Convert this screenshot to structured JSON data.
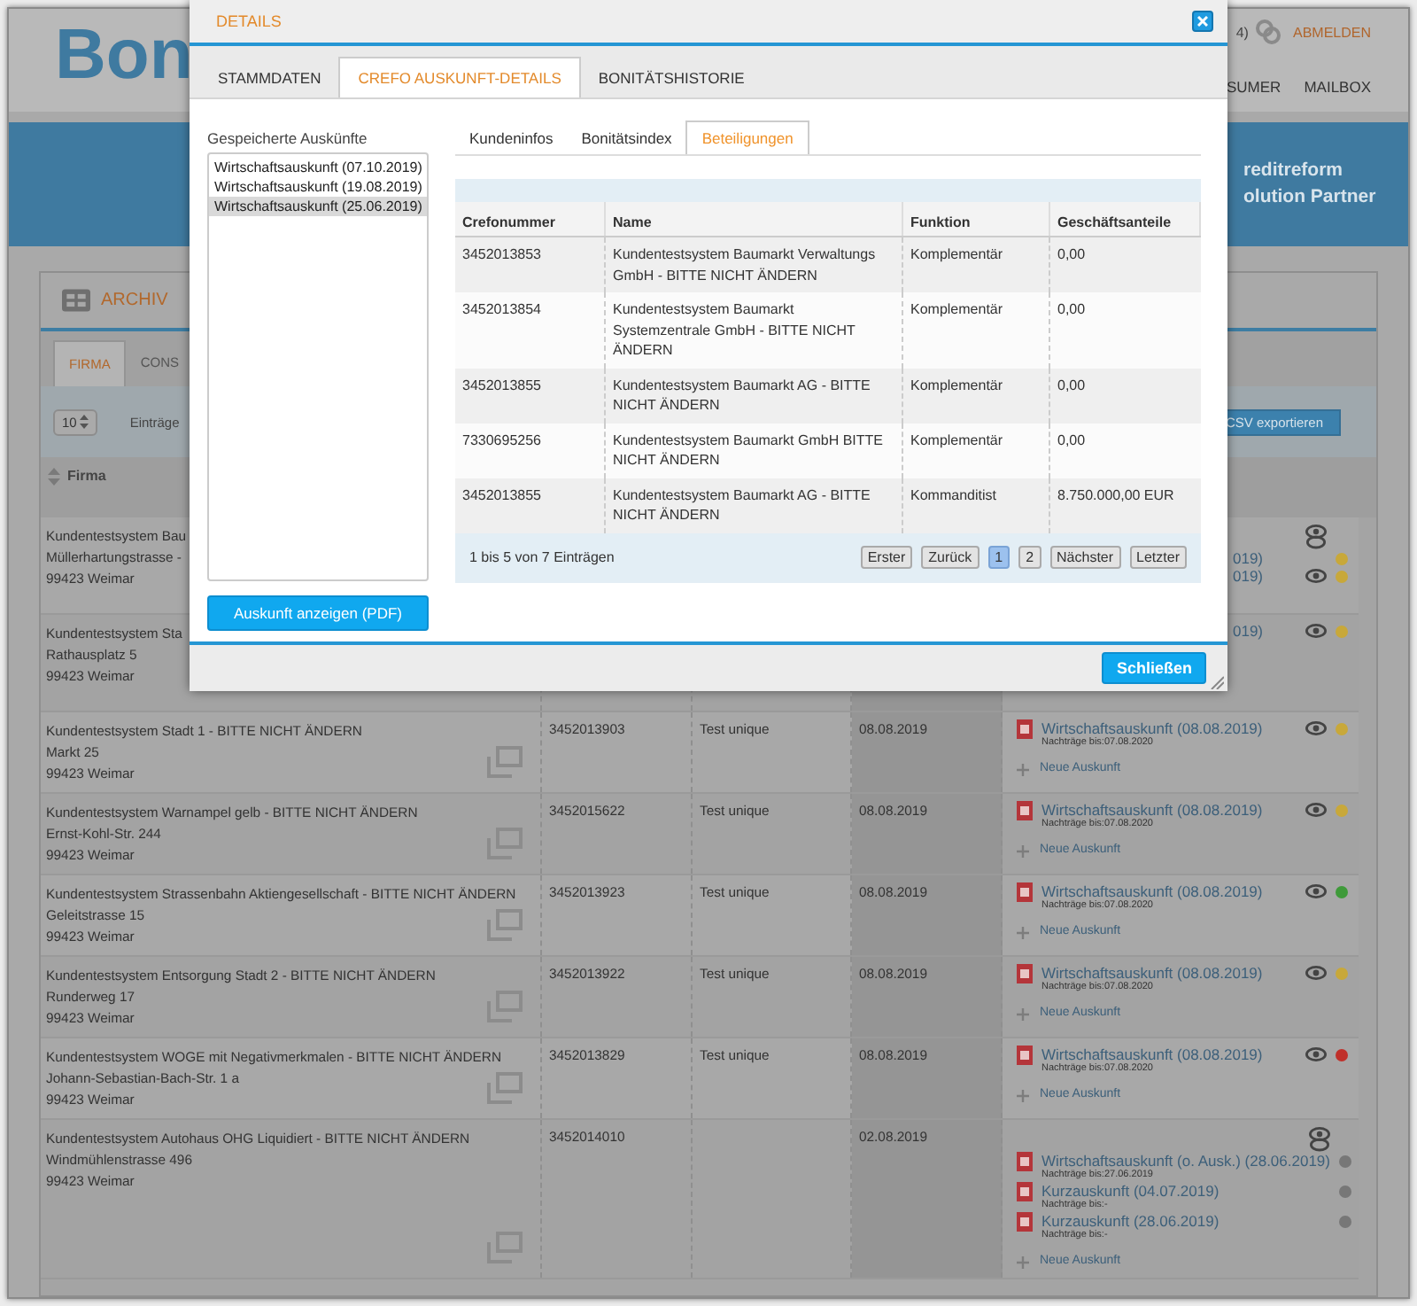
{
  "header": {
    "logo": "Bon",
    "badge": "4)",
    "logout": "ABMELDEN",
    "nav": [
      "SUMER",
      "MAILBOX"
    ]
  },
  "banner": {
    "lines": [
      "reditreform",
      "olution Partner"
    ]
  },
  "archive": {
    "title": "ARCHIV",
    "tabs": [
      {
        "label": "FIRMA",
        "selected": true
      },
      {
        "label": "CONS",
        "selected": false
      }
    ],
    "page_size": "10",
    "entries_label": "Einträge",
    "export_button": "CSV exportieren",
    "column_header": "Firma",
    "rows": [
      {
        "company": "Kundentestsystem Bau",
        "street": "Müllerhartungstrasse -",
        "city": "99423 Weimar",
        "double_eye": true,
        "reports": [
          {
            "title": "019)",
            "color": "#c8a83a",
            "eye": false
          },
          {
            "title": "019)",
            "color": "#c8a83a",
            "eye": true
          }
        ]
      },
      {
        "company": "Kundentestsystem Sta",
        "street": "Rathausplatz 5",
        "city": "99423 Weimar",
        "reports": [
          {
            "title": "019)",
            "color": "#c8a83a",
            "eye": true
          }
        ]
      },
      {
        "company": "Kundentestsystem Stadt 1 - BITTE NICHT ÄNDERN",
        "street": "Markt 25",
        "city": "99423 Weimar",
        "crefo": "3452013903",
        "ref": "Test unique",
        "date": "08.08.2019",
        "reports": [
          {
            "title": "Wirtschaftsauskunft (08.08.2019)",
            "note": "Nachträge bis:07.08.2020",
            "color": "#c8a83a",
            "eye": true
          }
        ],
        "new_report": "Neue Auskunft"
      },
      {
        "company": "Kundentestsystem Warnampel gelb - BITTE NICHT ÄNDERN",
        "street": "Ernst-Kohl-Str. 244",
        "city": "99423 Weimar",
        "crefo": "3452015622",
        "ref": "Test unique",
        "date": "08.08.2019",
        "reports": [
          {
            "title": "Wirtschaftsauskunft (08.08.2019)",
            "note": "Nachträge bis:07.08.2020",
            "color": "#c8a83a",
            "eye": true
          }
        ],
        "new_report": "Neue Auskunft"
      },
      {
        "company": "Kundentestsystem Strassenbahn Aktiengesellschaft - BITTE NICHT ÄNDERN",
        "street": "Geleitstrasse 15",
        "city": "99423 Weimar",
        "crefo": "3452013923",
        "ref": "Test unique",
        "date": "08.08.2019",
        "reports": [
          {
            "title": "Wirtschaftsauskunft (08.08.2019)",
            "note": "Nachträge bis:07.08.2020",
            "color": "#3f9a3a",
            "eye": true
          }
        ],
        "new_report": "Neue Auskunft"
      },
      {
        "company": "Kundentestsystem Entsorgung Stadt 2 - BITTE NICHT ÄNDERN",
        "street": "Runderweg 17",
        "city": "99423 Weimar",
        "crefo": "3452013922",
        "ref": "Test unique",
        "date": "08.08.2019",
        "reports": [
          {
            "title": "Wirtschaftsauskunft (08.08.2019)",
            "note": "Nachträge bis:07.08.2020",
            "color": "#c8a83a",
            "eye": true
          }
        ],
        "new_report": "Neue Auskunft"
      },
      {
        "company": "Kundentestsystem WOGE mit Negativmerkmalen - BITTE NICHT ÄNDERN",
        "street": "Johann-Sebastian-Bach-Str. 1 a",
        "city": "99423 Weimar",
        "crefo": "3452013829",
        "ref": "Test unique",
        "date": "08.08.2019",
        "reports": [
          {
            "title": "Wirtschaftsauskunft (08.08.2019)",
            "note": "Nachträge bis:07.08.2020",
            "color": "#c0302a",
            "eye": true
          }
        ],
        "new_report": "Neue Auskunft"
      },
      {
        "company": "Kundentestsystem Autohaus OHG Liquidiert - BITTE NICHT ÄNDERN",
        "street": "Windmühlenstrasse 496",
        "city": "99423 Weimar",
        "crefo": "3452014010",
        "date": "02.08.2019",
        "double_eye": true,
        "reports": [
          {
            "title": "Wirtschaftsauskunft (o. Ausk.) (28.06.2019)",
            "note": "Nachträge bis:27.06.2019",
            "color": "#777777",
            "eye": false
          },
          {
            "title": "Kurzauskunft (04.07.2019)",
            "note": "Nachträge bis:-",
            "color": "#777777",
            "eye": false
          },
          {
            "title": "Kurzauskunft (28.06.2019)",
            "note": "Nachträge bis:-",
            "color": "#777777",
            "eye": false
          }
        ],
        "new_report": "Neue Auskunft"
      }
    ]
  },
  "dialog": {
    "title": "DETAILS",
    "tabs": [
      {
        "label": "STAMMDATEN",
        "selected": false
      },
      {
        "label": "CREFO AUSKUNFT-DETAILS",
        "selected": true
      },
      {
        "label": "BONITÄTSHISTORIE",
        "selected": false
      }
    ],
    "saved_label": "Gespeicherte Auskünfte",
    "saved": [
      {
        "label": "Wirtschaftsauskunft (07.10.2019)",
        "selected": false
      },
      {
        "label": "Wirtschaftsauskunft (19.08.2019)",
        "selected": false
      },
      {
        "label": "Wirtschaftsauskunft (25.06.2019)",
        "selected": true
      }
    ],
    "pdf_button": "Auskunft anzeigen (PDF)",
    "subtabs": [
      {
        "label": "Kundeninfos",
        "selected": false
      },
      {
        "label": "Bonitätsindex",
        "selected": false
      },
      {
        "label": "Beteiligungen",
        "selected": true
      }
    ],
    "table": {
      "columns": [
        "Crefonummer",
        "Name",
        "Funktion",
        "Geschäftsanteile"
      ],
      "rows": [
        [
          "3452013853",
          "Kundentestsystem Baumarkt Verwaltungs GmbH - BITTE NICHT ÄNDERN",
          "Komplementär",
          "0,00"
        ],
        [
          "3452013854",
          "Kundentestsystem Baumarkt Systemzentrale GmbH - BITTE NICHT ÄNDERN",
          "Komplementär",
          "0,00"
        ],
        [
          "3452013855",
          "Kundentestsystem Baumarkt AG - BITTE NICHT ÄNDERN",
          "Komplementär",
          "0,00"
        ],
        [
          "7330695256",
          "Kundentestsystem Baumarkt GmbH BITTE NICHT ÄNDERN",
          "Komplementär",
          "0,00"
        ],
        [
          "3452013855",
          "Kundentestsystem Baumarkt AG - BITTE NICHT ÄNDERN",
          "Kommanditist",
          "8.750.000,00 EUR"
        ]
      ]
    },
    "summary": "1 bis 5 von 7 Einträgen",
    "pager": [
      {
        "label": "Erster",
        "selected": false
      },
      {
        "label": "Zurück",
        "selected": false
      },
      {
        "label": "1",
        "selected": true
      },
      {
        "label": "2",
        "selected": false
      },
      {
        "label": "Nächster",
        "selected": false
      },
      {
        "label": "Letzter",
        "selected": false
      }
    ],
    "close_button": "Schließen"
  }
}
